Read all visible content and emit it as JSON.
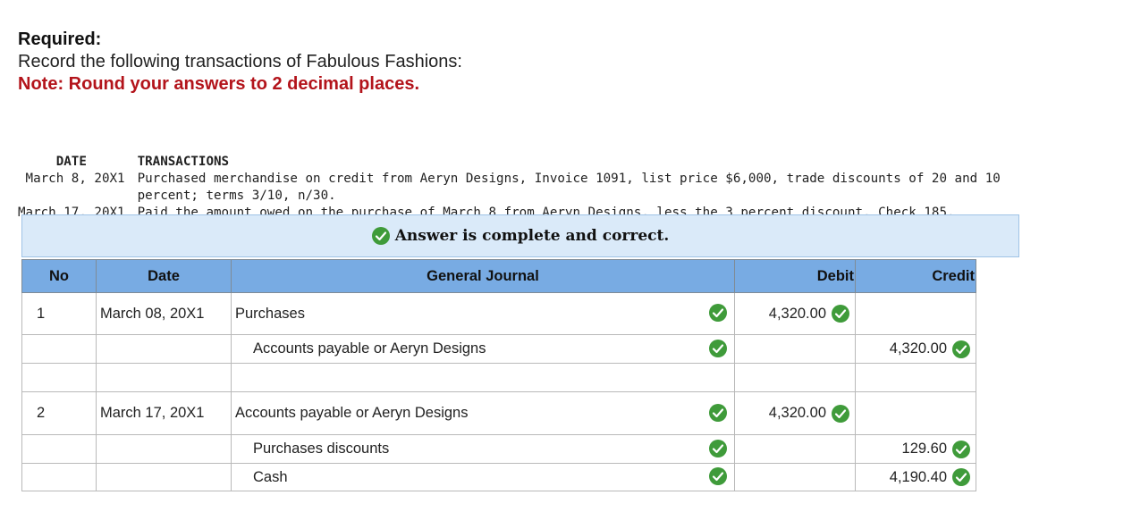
{
  "required": {
    "heading": "Required:",
    "instruction": "Record the following transactions of Fabulous Fashions:",
    "note": "Note: Round your answers to 2 decimal places."
  },
  "transactions": {
    "date_header": "DATE",
    "trans_header": "TRANSACTIONS",
    "rows": [
      {
        "date": "March 8, 20X1",
        "text": "Purchased merchandise on credit from Aeryn Designs, Invoice 1091, list price $6,000, trade discounts of 20 and 10\npercent; terms 3/10, n/30."
      },
      {
        "date": "March 17, 20X1",
        "text": "Paid the amount owed on the purchase of March 8 from Aeryn Designs, less the 3 percent discount, Check 185."
      }
    ]
  },
  "banner": {
    "text": "Answer is complete and correct.",
    "icon": "check-circle-icon",
    "color": "#3f9b3a"
  },
  "journal": {
    "headers": {
      "no": "No",
      "date": "Date",
      "account": "General Journal",
      "debit": "Debit",
      "credit": "Credit"
    },
    "rows": [
      {
        "no": "1",
        "date": "March 08, 20X1",
        "account": "Purchases",
        "debit": "4,320.00",
        "credit": ""
      },
      {
        "no": "",
        "date": "",
        "account": "Accounts payable or Aeryn Designs",
        "debit": "",
        "credit": "4,320.00"
      },
      {
        "no": "",
        "date": "",
        "account": "",
        "debit": "",
        "credit": ""
      },
      {
        "no": "2",
        "date": "March 17, 20X1",
        "account": "Accounts payable or Aeryn Designs",
        "debit": "4,320.00",
        "credit": ""
      },
      {
        "no": "",
        "date": "",
        "account": "Purchases discounts",
        "debit": "",
        "credit": "129.60"
      },
      {
        "no": "",
        "date": "",
        "account": "Cash",
        "debit": "",
        "credit": "4,190.40"
      }
    ]
  },
  "colors": {
    "header_bg": "#78abe3",
    "banner_bg": "#daeaf9",
    "note_red": "#b3141b",
    "check_green": "#3f9b3a"
  }
}
